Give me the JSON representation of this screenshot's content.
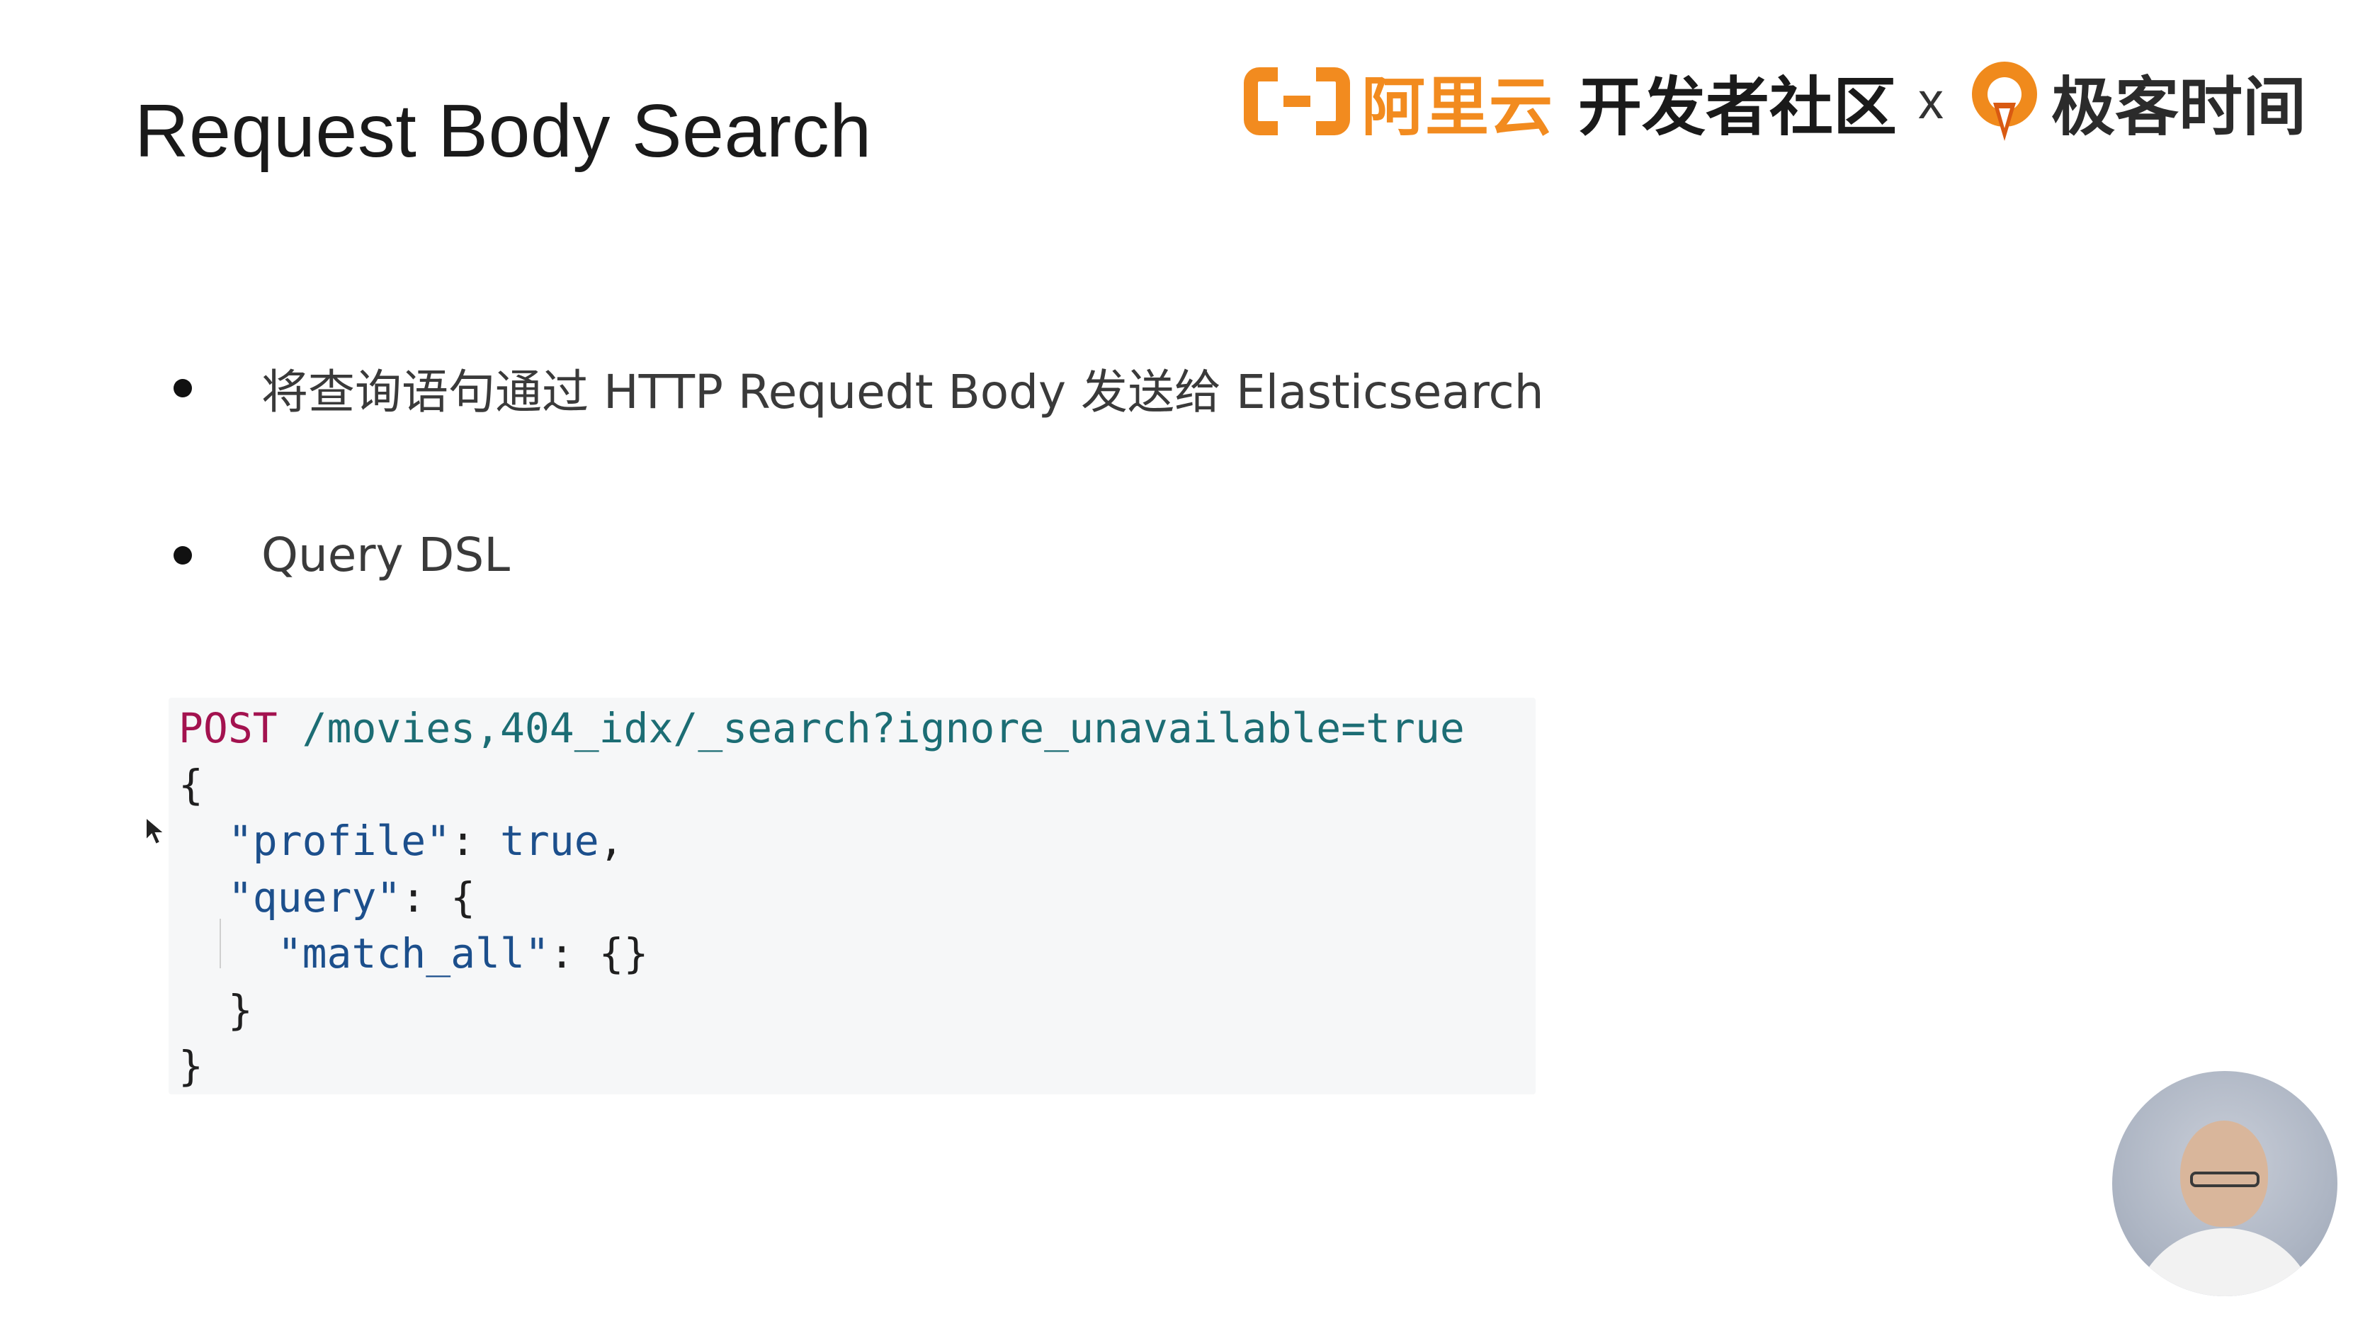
{
  "slide": {
    "title": "Request Body Search"
  },
  "brand": {
    "aliyun": "阿里云",
    "developer_community": "开发者社区",
    "separator": "x",
    "geektime": "极客时间",
    "colors": {
      "aliyun_orange": "#f28b1f",
      "geektime_orange": "#f08a1c"
    }
  },
  "bullets": [
    {
      "text": "将查询语句通过 HTTP Requedt Body 发送给 Elasticsearch"
    },
    {
      "text": "Query DSL"
    }
  ],
  "code": {
    "method": "POST",
    "url": "/movies,404_idx/_search?ignore_unavailable=true",
    "open_brace": "{",
    "profile_key": "\"profile\"",
    "colon": ":",
    "profile_value": "true",
    "comma": ",",
    "query_key": "\"query\"",
    "query_open": "{",
    "match_all_key": "\"match_all\"",
    "match_all_value": "{}",
    "query_close": "}",
    "close_brace": "}"
  },
  "presenter": {
    "icon": "presenter-avatar"
  }
}
